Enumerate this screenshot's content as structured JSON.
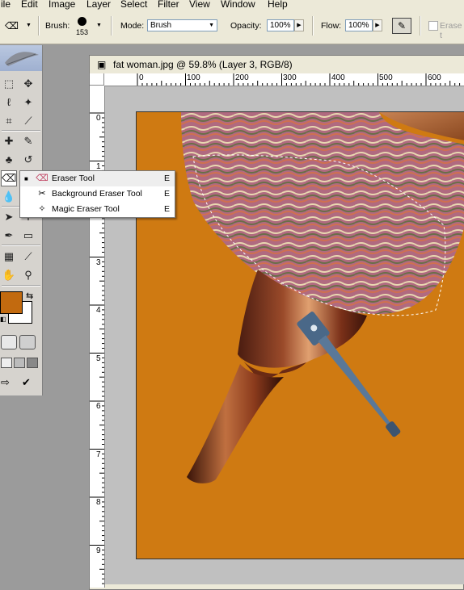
{
  "menu": [
    "ile",
    "Edit",
    "Image",
    "Layer",
    "Select",
    "Filter",
    "View",
    "Window",
    "Help"
  ],
  "options": {
    "brush_label": "Brush:",
    "brush_size": "153",
    "mode_label": "Mode:",
    "mode_value": "Brush",
    "opacity_label": "Opacity:",
    "opacity_value": "100%",
    "flow_label": "Flow:",
    "flow_value": "100%",
    "erase_history_label": "Erase t"
  },
  "document": {
    "title": "fat woman.jpg @ 59.8% (Layer 3, RGB/8)",
    "h_ruler": [
      "0",
      "100",
      "200",
      "300",
      "400",
      "500",
      "600"
    ],
    "v_ruler": [
      "0",
      "1",
      "2",
      "3",
      "4",
      "5",
      "6",
      "7",
      "8",
      "9"
    ]
  },
  "colors": {
    "foreground": "#c26a0f",
    "background": "#ffffff",
    "image_orange": "#cf7a12"
  },
  "flyout": {
    "items": [
      {
        "label": "Eraser Tool",
        "shortcut": "E",
        "icon": "eraser-icon",
        "selected": true
      },
      {
        "label": "Background Eraser Tool",
        "shortcut": "E",
        "icon": "background-eraser-icon",
        "selected": false
      },
      {
        "label": "Magic Eraser Tool",
        "shortcut": "E",
        "icon": "magic-eraser-icon",
        "selected": false
      }
    ]
  },
  "toolbox": {
    "tools": [
      "marquee-icon",
      "move-icon",
      "lasso-icon",
      "magic-wand-icon",
      "crop-icon",
      "slice-icon",
      "healing-brush-icon",
      "brush-icon",
      "clone-stamp-icon",
      "history-brush-icon",
      "eraser-icon",
      "gradient-icon",
      "blur-icon",
      "dodge-icon",
      "path-selection-icon",
      "type-icon",
      "pen-icon",
      "shape-icon",
      "notes-icon",
      "eyedropper-icon",
      "hand-icon",
      "zoom-icon"
    ]
  }
}
